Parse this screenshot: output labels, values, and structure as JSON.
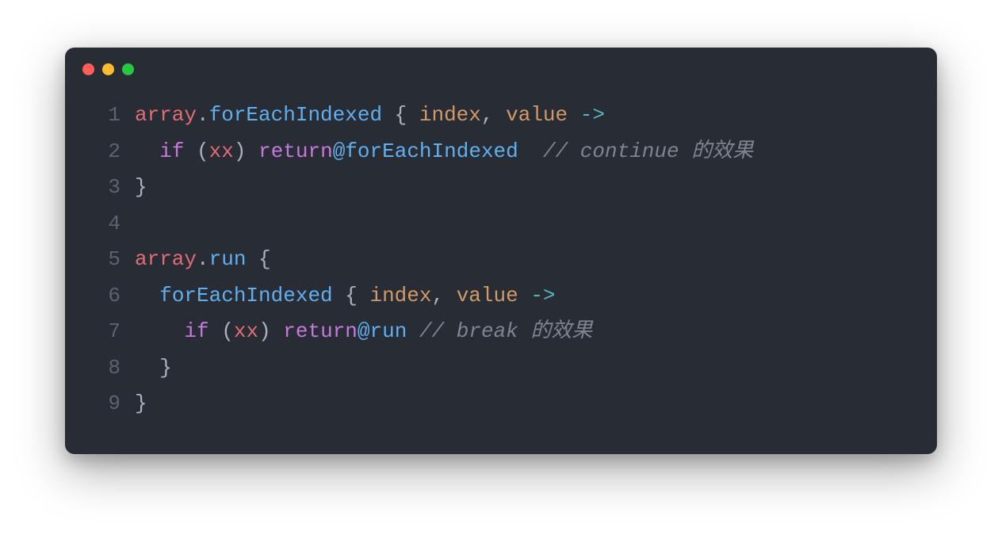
{
  "window": {
    "lines": [
      {
        "num": "1",
        "tokens": [
          {
            "text": "array",
            "cls": "t-red"
          },
          {
            "text": ".",
            "cls": "t-default"
          },
          {
            "text": "forEachIndexed",
            "cls": "t-blue"
          },
          {
            "text": " { ",
            "cls": "t-default"
          },
          {
            "text": "index",
            "cls": "t-orange"
          },
          {
            "text": ", ",
            "cls": "t-default"
          },
          {
            "text": "value",
            "cls": "t-orange"
          },
          {
            "text": " ",
            "cls": "t-default"
          },
          {
            "text": "->",
            "cls": "t-cyan"
          }
        ]
      },
      {
        "num": "2",
        "tokens": [
          {
            "text": "  ",
            "cls": "t-default"
          },
          {
            "text": "if",
            "cls": "t-purple"
          },
          {
            "text": " (",
            "cls": "t-default"
          },
          {
            "text": "xx",
            "cls": "t-red"
          },
          {
            "text": ") ",
            "cls": "t-default"
          },
          {
            "text": "return",
            "cls": "t-purple"
          },
          {
            "text": "@forEachIndexed",
            "cls": "t-blue"
          },
          {
            "text": "  ",
            "cls": "t-default"
          },
          {
            "text": "// continue 的效果",
            "cls": "t-comment"
          }
        ]
      },
      {
        "num": "3",
        "tokens": [
          {
            "text": "}",
            "cls": "t-default"
          }
        ]
      },
      {
        "num": "4",
        "tokens": []
      },
      {
        "num": "5",
        "tokens": [
          {
            "text": "array",
            "cls": "t-red"
          },
          {
            "text": ".",
            "cls": "t-default"
          },
          {
            "text": "run",
            "cls": "t-blue"
          },
          {
            "text": " {",
            "cls": "t-default"
          }
        ]
      },
      {
        "num": "6",
        "tokens": [
          {
            "text": "  ",
            "cls": "t-default"
          },
          {
            "text": "forEachIndexed",
            "cls": "t-blue"
          },
          {
            "text": " { ",
            "cls": "t-default"
          },
          {
            "text": "index",
            "cls": "t-orange"
          },
          {
            "text": ", ",
            "cls": "t-default"
          },
          {
            "text": "value",
            "cls": "t-orange"
          },
          {
            "text": " ",
            "cls": "t-default"
          },
          {
            "text": "->",
            "cls": "t-cyan"
          }
        ]
      },
      {
        "num": "7",
        "tokens": [
          {
            "text": "    ",
            "cls": "t-default"
          },
          {
            "text": "if",
            "cls": "t-purple"
          },
          {
            "text": " (",
            "cls": "t-default"
          },
          {
            "text": "xx",
            "cls": "t-red"
          },
          {
            "text": ") ",
            "cls": "t-default"
          },
          {
            "text": "return",
            "cls": "t-purple"
          },
          {
            "text": "@run",
            "cls": "t-blue"
          },
          {
            "text": " ",
            "cls": "t-default"
          },
          {
            "text": "// break 的效果",
            "cls": "t-comment"
          }
        ]
      },
      {
        "num": "8",
        "tokens": [
          {
            "text": "  }",
            "cls": "t-default"
          }
        ]
      },
      {
        "num": "9",
        "tokens": [
          {
            "text": "}",
            "cls": "t-default"
          }
        ]
      }
    ]
  }
}
